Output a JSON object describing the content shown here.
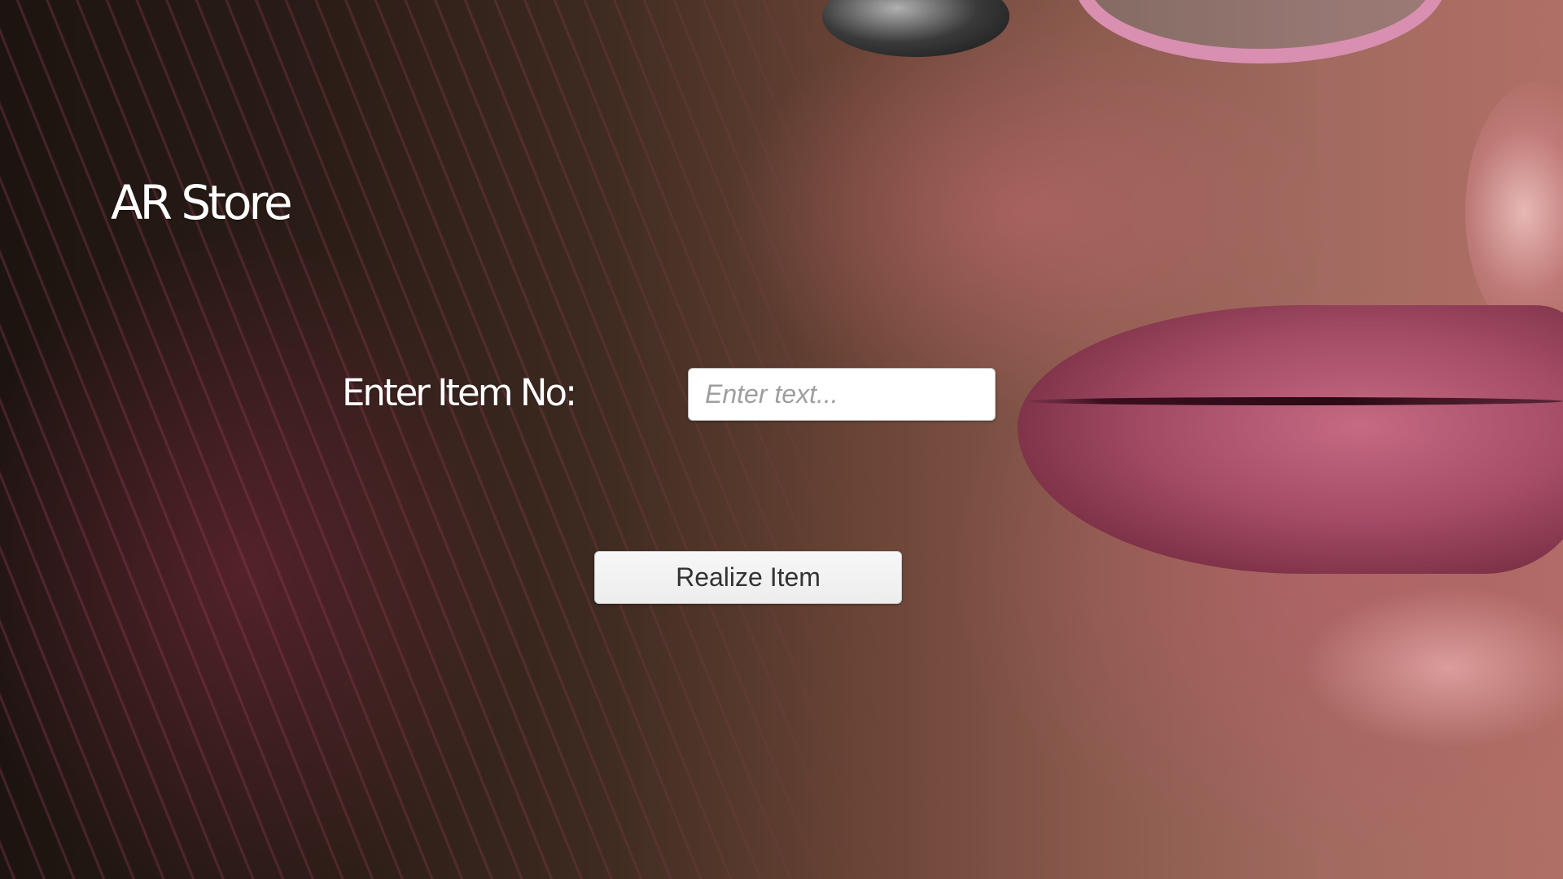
{
  "app": {
    "title": "AR Store"
  },
  "form": {
    "item_label": "Enter Item No:",
    "item_input": {
      "value": "",
      "placeholder": "Enter text..."
    },
    "realize_button_label": "Realize Item"
  },
  "colors": {
    "text_on_image": "#ffffff",
    "input_background": "#ffffff",
    "button_background": "#f2f2f2",
    "button_text": "#333333",
    "placeholder_text": "#9e9e9e"
  }
}
